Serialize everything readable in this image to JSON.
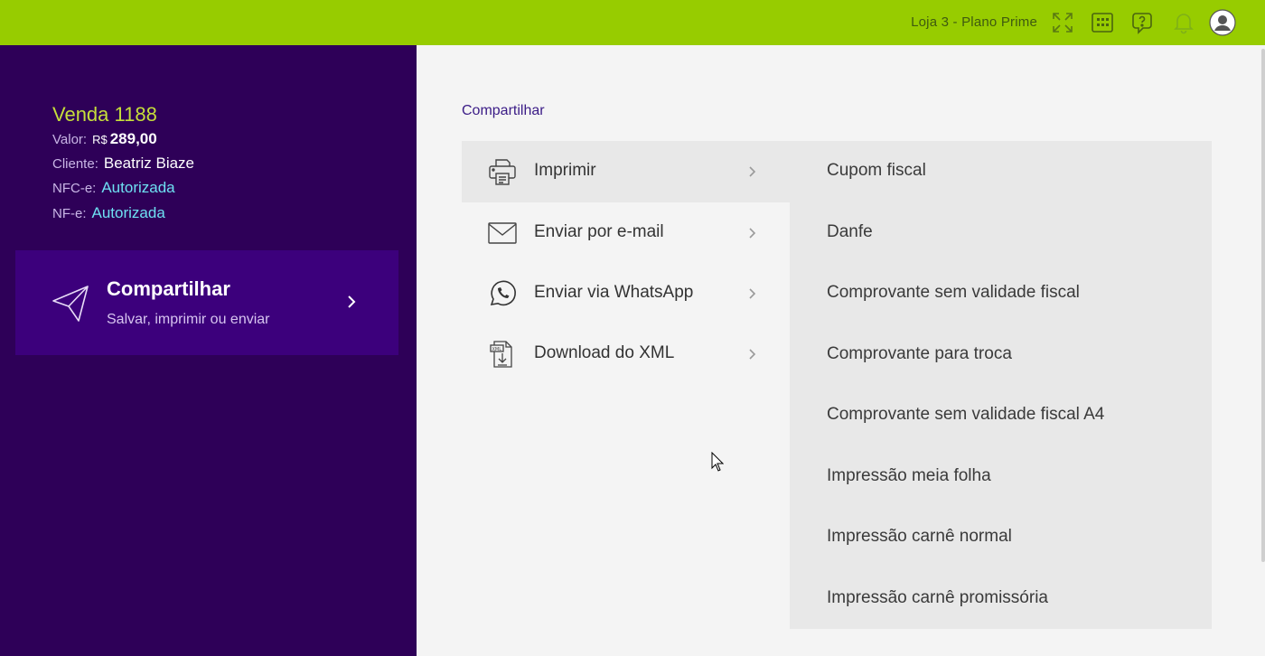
{
  "topbar": {
    "store_label": "Loja 3 - Plano Prime",
    "icons": [
      "expand-icon",
      "apps-grid-icon",
      "help-chat-icon",
      "bell-icon",
      "avatar-icon"
    ]
  },
  "sale": {
    "title": "Venda 1188",
    "valor_label": "Valor:",
    "currency": "R$",
    "amount": "289,00",
    "cliente_label": "Cliente:",
    "cliente": "Beatriz Biaze",
    "nfce_label": "NFC-e:",
    "nfce_status": "Autorizada",
    "nfe_label": "NF-e:",
    "nfe_status": "Autorizada"
  },
  "share_card": {
    "title": "Compartilhar",
    "subtitle": "Salvar, imprimir ou enviar"
  },
  "breadcrumb": "Compartilhar",
  "menu": [
    {
      "label": "Imprimir",
      "icon": "printer-icon",
      "active": true
    },
    {
      "label": "Enviar por e-mail",
      "icon": "mail-icon",
      "active": false
    },
    {
      "label": "Enviar via WhatsApp",
      "icon": "whatsapp-icon",
      "active": false
    },
    {
      "label": "Download do XML",
      "icon": "xml-file-icon",
      "active": false
    }
  ],
  "submenu": [
    "Cupom fiscal",
    "Danfe",
    "Comprovante sem validade fiscal",
    "Comprovante para troca",
    "Comprovante sem validade fiscal A4",
    "Impressão meia folha",
    "Impressão carnê normal",
    "Impressão carnê promissória"
  ],
  "colors": {
    "topbar": "#97cc00",
    "sidebar": "#2e0058",
    "card": "#3c007c",
    "accent_yellow": "#c6df3a",
    "link_cyan": "#6ee0f2"
  }
}
